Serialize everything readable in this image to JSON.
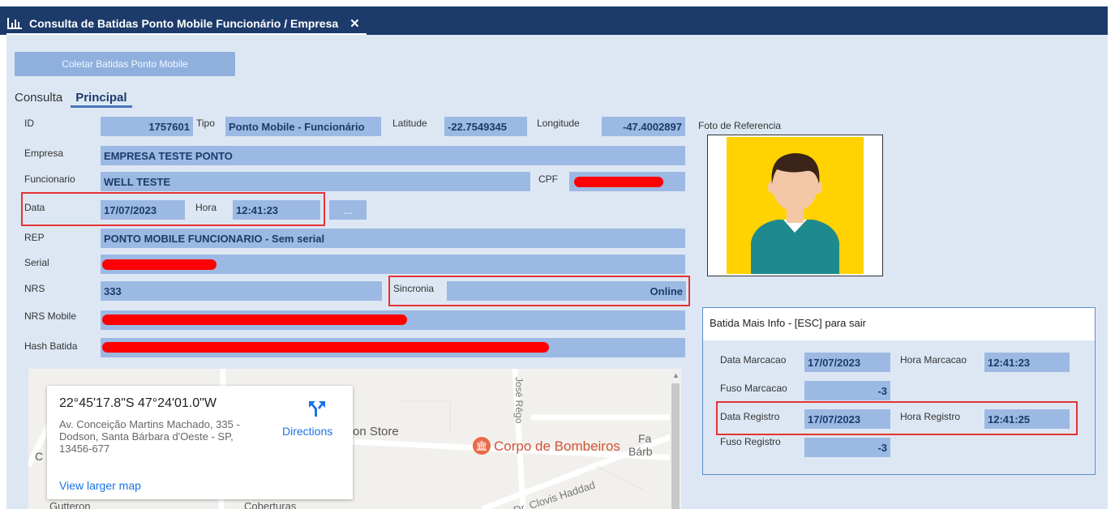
{
  "window": {
    "title": "Consulta de Batidas Ponto Mobile Funcionário / Empresa",
    "close": "✕"
  },
  "toolbar": {
    "coletar_label": "Coletar Batidas Ponto Mobile"
  },
  "tabs": [
    {
      "label": "Consulta"
    },
    {
      "label": "Principal"
    }
  ],
  "form": {
    "id_label": "ID",
    "id": "1757601",
    "tipo_label": "Tipo",
    "tipo": "Ponto Mobile - Funcionário",
    "latitude_label": "Latitude",
    "latitude": "-22.7549345",
    "longitude_label": "Longitude",
    "longitude": "-47.4002897",
    "empresa_label": "Empresa",
    "empresa": "EMPRESA TESTE PONTO",
    "funcionario_label": "Funcionario",
    "funcionario": "WELL TESTE",
    "cpf_label": "CPF",
    "data_label": "Data",
    "data": "17/07/2023",
    "hora_label": "Hora",
    "hora": "12:41:23",
    "more_label": "...",
    "rep_label": "REP",
    "rep": "PONTO MOBILE FUNCIONARIO - Sem serial",
    "serial_label": "Serial",
    "nrs_label": "NRS",
    "nrs": "333",
    "sincronia_label": "Sincronia",
    "sincronia": "Online",
    "nrs_mobile_label": "NRS Mobile",
    "hash_label": "Hash Batida"
  },
  "foto": {
    "label": "Foto de Referencia"
  },
  "map": {
    "coords": "22°45'17.8\"S 47°24'01.0\"W",
    "address": "Av. Conceição Martins Machado, 335 - Dodson, Santa Bárbara d'Oeste - SP, 13456-677",
    "directions": "Directions",
    "view_larger": "View larger map",
    "poi_store": "on Store",
    "poi_bombeiros": "Corpo de Bombeiros",
    "street_jose": "José Rêgo",
    "street_clovis": "R. Dr. Clovis Haddad",
    "frag_fa": "Fa",
    "frag_barb": "Bárb",
    "frag_c": "C",
    "frag_bottom1": "Gutteron",
    "frag_bottom2": "Coberturas"
  },
  "popup": {
    "title": "Batida Mais Info - [ESC] para sair",
    "data_marcacao_label": "Data Marcacao",
    "data_marcacao": "17/07/2023",
    "hora_marcacao_label": "Hora Marcacao",
    "hora_marcacao": "12:41:23",
    "fuso_marcacao_label": "Fuso Marcacao",
    "fuso_marcacao": "-3",
    "data_registro_label": "Data Registro",
    "data_registro": "17/07/2023",
    "hora_registro_label": "Hora Registro",
    "hora_registro": "12:41:25",
    "fuso_registro_label": "Fuso Registro",
    "fuso_registro": "-3"
  },
  "colors": {
    "titlebar": "#1c3b6b",
    "field": "#9cb9e3",
    "background": "#dde7f4",
    "highlight": "#e53333",
    "redaction": "#ff0000",
    "link": "#1a73e8"
  },
  "icons": {
    "window": "bar-chart-icon",
    "directions": "directions-icon",
    "poi": "fire-station-icon"
  }
}
